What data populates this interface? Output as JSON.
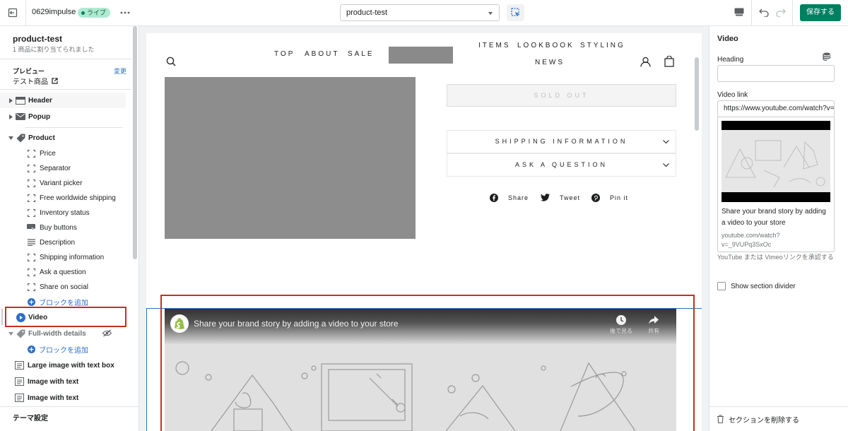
{
  "topbar": {
    "store_name": "0629impulse",
    "live_badge": "ライブ",
    "template_select": "product-test",
    "save_label": "保存する"
  },
  "sidebar": {
    "page_title": "product-test",
    "page_subtitle": "1 商品に割り当てられました",
    "preview_label": "プレビュー",
    "preview_change": "変更",
    "preview_value": "テスト商品",
    "sections": {
      "header": "Header",
      "popup": "Popup",
      "product": "Product",
      "video": "Video",
      "full_width": "Full-width details",
      "large_image": "Large image with text box",
      "image_text_1": "Image with text",
      "image_text_2": "Image with text"
    },
    "product_blocks": [
      "Price",
      "Separator",
      "Variant picker",
      "Free worldwide shipping",
      "Inventory status",
      "Buy buttons",
      "Description",
      "Shipping information",
      "Ask a question",
      "Share on social"
    ],
    "add_block_1": "ブロックを追加",
    "add_block_2": "ブロックを追加",
    "theme_settings": "テーマ設定"
  },
  "preview": {
    "nav_left": [
      "TOP",
      "ABOUT",
      "SALE"
    ],
    "nav_right": [
      "ITEMS",
      "LOOKBOOK",
      "STYLING",
      "NEWS"
    ],
    "sold_out": "SOLD OUT",
    "accordion": [
      "SHIPPING INFORMATION",
      "ASK A QUESTION"
    ],
    "share": {
      "facebook": "Share",
      "twitter": "Tweet",
      "pinterest": "Pin it"
    },
    "video_title": "Share your brand story by adding a video to your store",
    "video_watch_later": "後で見る",
    "video_share": "共有"
  },
  "panel": {
    "title": "Video",
    "heading_label": "Heading",
    "heading_value": "",
    "video_link_label": "Video link",
    "video_link_value": "https://www.youtube.com/watch?v=_9VUPq3SxOc",
    "card_title": "Share your brand story by adding a video to your store",
    "card_url": "youtube.com/watch?v=_9VUPq3SxOc",
    "help_text": "YouTube または Vimeoリンクを承認する",
    "divider_label": "Show section divider",
    "delete_label": "セクションを削除する"
  },
  "colors": {
    "primary": "#008060",
    "highlight": "#c4321b",
    "selection": "#2c6ecb",
    "link": "#2c6ecb"
  }
}
